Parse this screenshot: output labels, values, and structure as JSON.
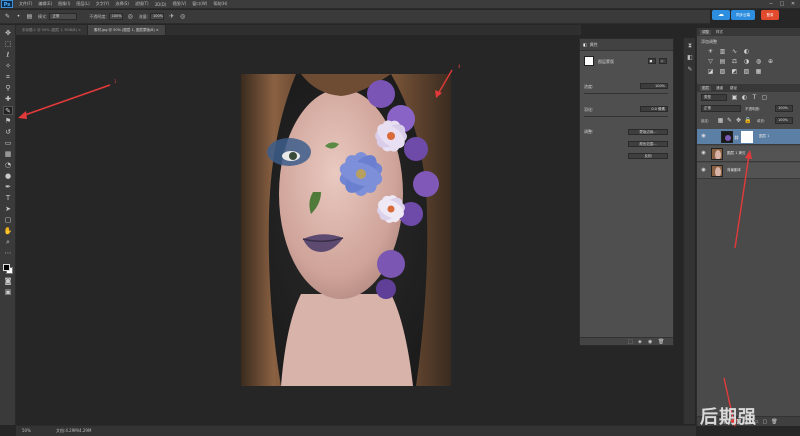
{
  "app": {
    "logo": "Ps"
  },
  "menu": [
    "文件(F)",
    "编辑(E)",
    "图像(I)",
    "图层(L)",
    "文字(Y)",
    "选择(S)",
    "滤镜(T)",
    "3D(D)",
    "视图(V)",
    "窗口(W)",
    "帮助(H)"
  ],
  "window_controls": [
    "─",
    "□",
    "✕"
  ],
  "top_right": {
    "cloud_icon": "cloud-icon",
    "blue_button": "同步云端",
    "red_button": "登录"
  },
  "options_bar": {
    "mode_label": "模式:",
    "mode_value": "正常",
    "opacity_label": "不透明度:",
    "opacity_value": "100%",
    "flow_label": "流量:",
    "flow_value": "100%"
  },
  "tabs": [
    {
      "label": "未标题-1 @ 50% (图层 1, RGB/8) ×",
      "active": false
    },
    {
      "label": "素材.jpg @ 50% (图层 1, 图层蒙版/8) ×",
      "active": true
    }
  ],
  "properties_panel": {
    "title": "属性",
    "subtitle": "图层蒙版",
    "density_label": "浓度:",
    "density_value": "100%",
    "feather_label": "羽化:",
    "feather_value": "0.0 像素",
    "refine_label": "调整:",
    "buttons": [
      "蒙版边缘...",
      "颜色范围...",
      "反相"
    ]
  },
  "right_panel": {
    "tabs_top": [
      "调整",
      "样式"
    ],
    "adjust_title": "添加调整",
    "tabs_layers": [
      "图层",
      "通道",
      "路径"
    ],
    "kind_label": "类型",
    "blend_mode": "正常",
    "opacity_label": "不透明度:",
    "opacity_value": "100%",
    "lock_label": "锁定:",
    "fill_label": "填充:",
    "fill_value": "100%",
    "layers": [
      {
        "name": "图层 1",
        "selected": true
      },
      {
        "name": "图层 1 拷贝",
        "selected": false
      },
      {
        "name": "背景副本",
        "selected": false
      }
    ],
    "footer_icons": [
      "link-icon",
      "fx-icon",
      "mask-icon",
      "adjust-icon",
      "folder-icon",
      "new-layer-icon",
      "trash-icon"
    ]
  },
  "status": {
    "zoom": "50%",
    "doc": "文档:4.29M/4.29M"
  },
  "annotations": [
    "1",
    "4"
  ],
  "watermark": "后期强",
  "colors": {
    "arrow": "#e23a3a",
    "accent": "#2d8ee0",
    "selection": "#5c7fa6"
  }
}
